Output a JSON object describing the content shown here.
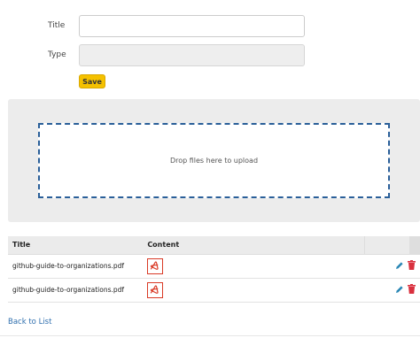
{
  "form": {
    "title_label": "Title",
    "title_value": "",
    "type_label": "Type",
    "type_value": "",
    "save_label": "Save"
  },
  "dropzone": {
    "text": "Drop files here to upload"
  },
  "table": {
    "headers": {
      "title": "Title",
      "content": "Content"
    },
    "rows": [
      {
        "title": "github-guide-to-organizations.pdf",
        "content_icon": "pdf-icon"
      },
      {
        "title": "github-guide-to-organizations.pdf",
        "content_icon": "pdf-icon"
      }
    ]
  },
  "footer": {
    "back_label": "Back to List"
  },
  "colors": {
    "save_button": "#f5c100",
    "dropzone_border": "#2a5f99",
    "pdf_icon": "#d93a26",
    "edit_icon": "#2a87b5",
    "delete_icon": "#d9303e",
    "link": "#2f6fae"
  }
}
